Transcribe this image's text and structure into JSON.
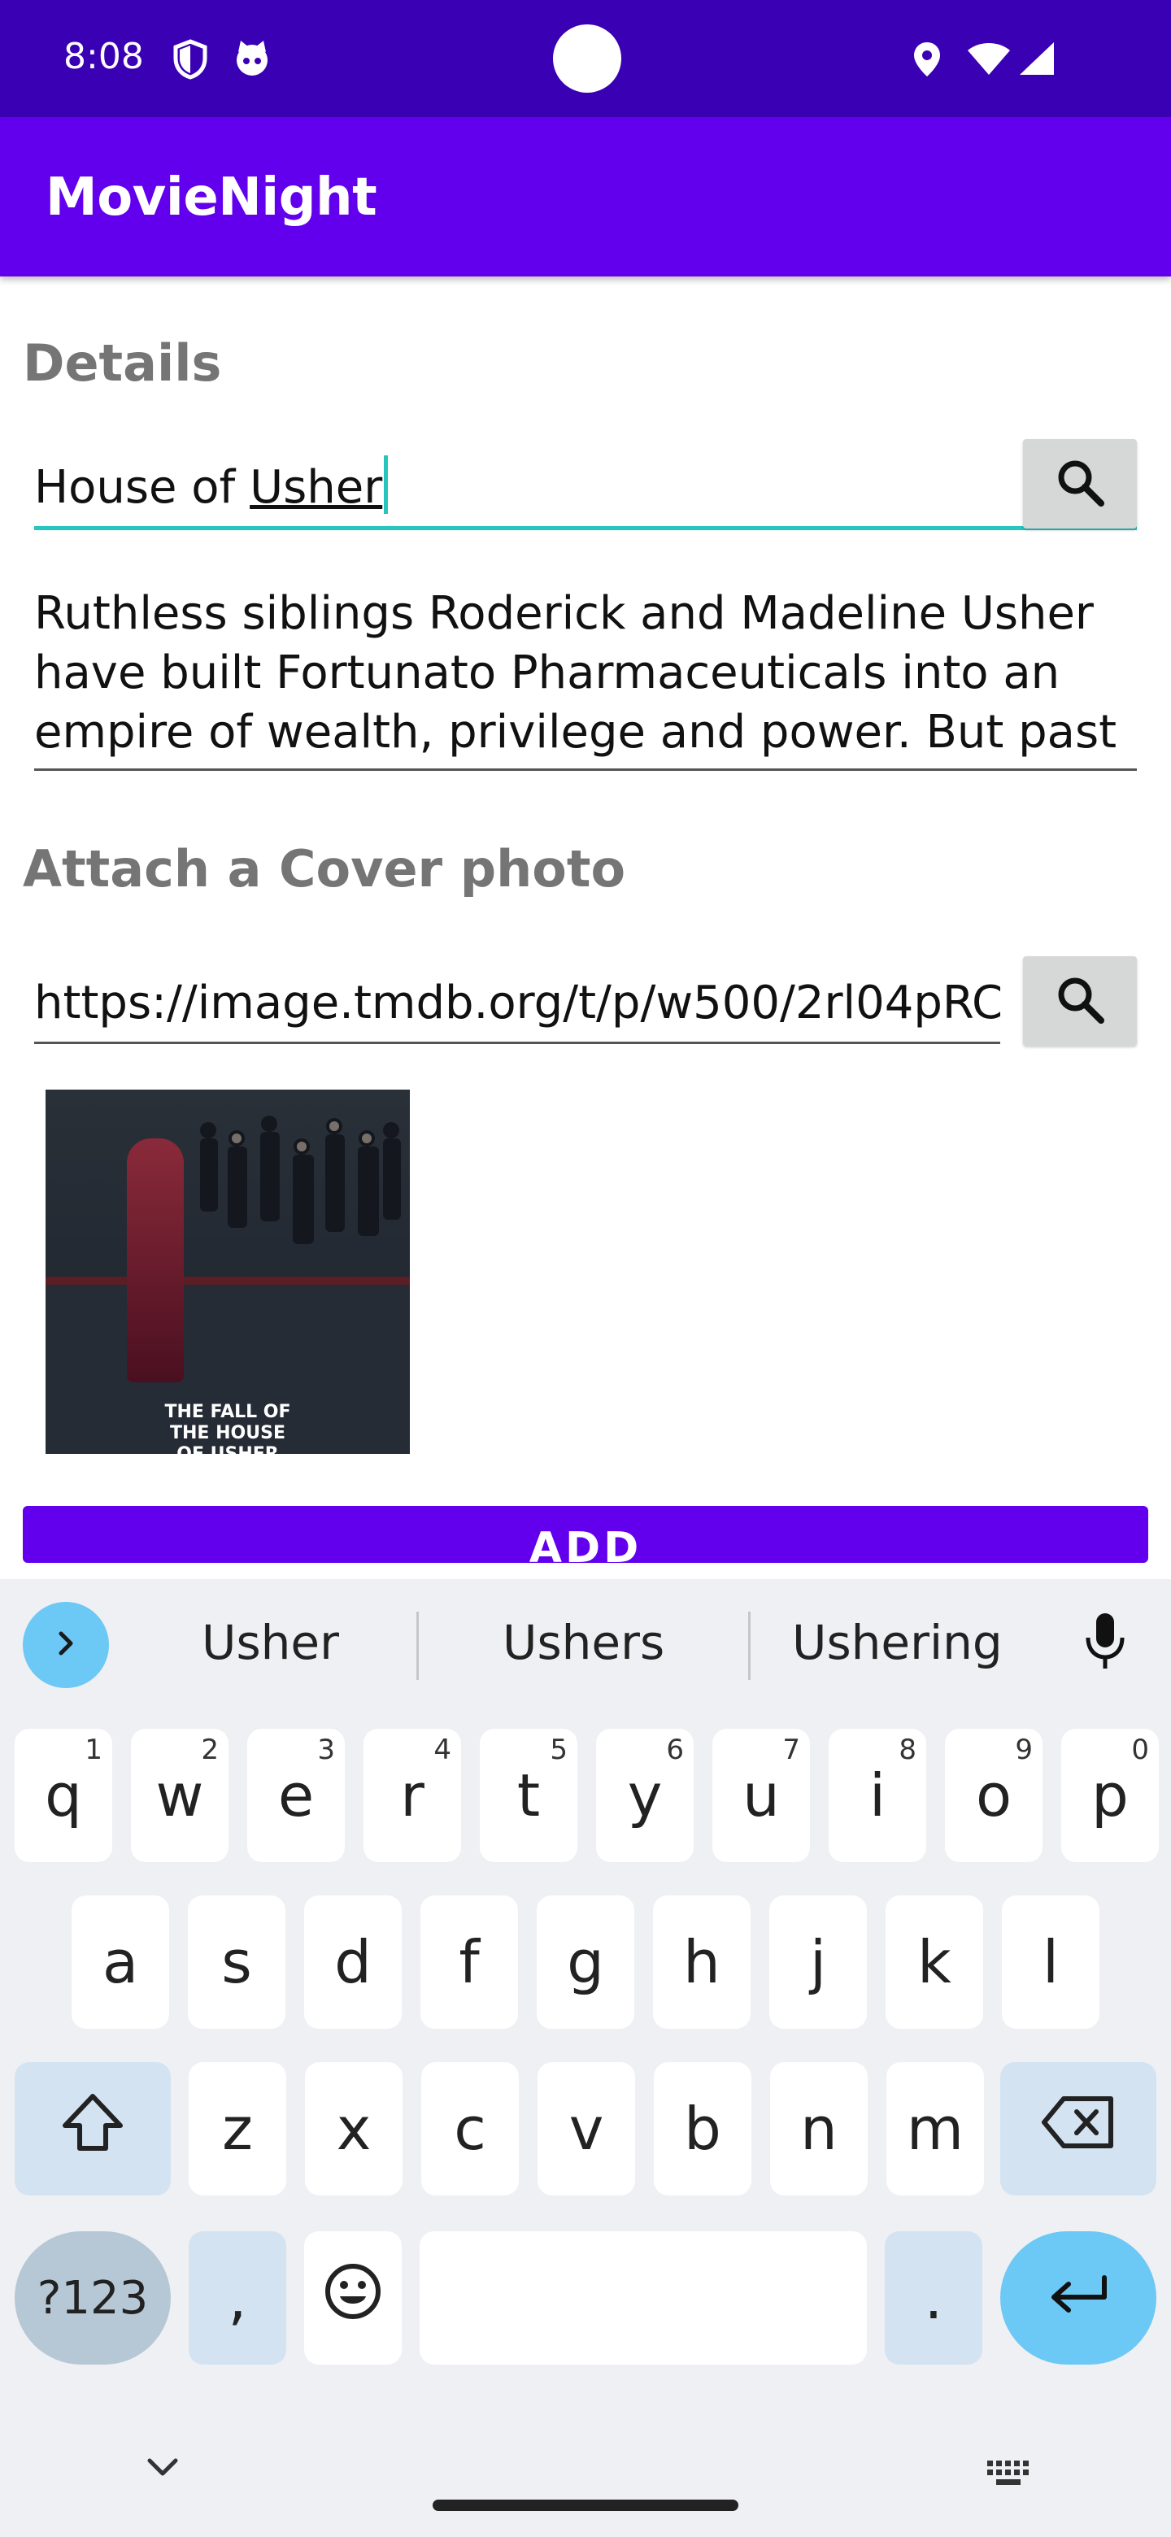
{
  "status_bar": {
    "time": "8:08"
  },
  "app": {
    "title": "MovieNight"
  },
  "form": {
    "details_label": "Details",
    "title_value_plain": "House of ",
    "title_value_underlined": "Usher",
    "description": "Ruthless siblings Roderick and Madeline Usher have built Fortunato Pharmaceuticals into an empire of wealth, privilege and power. But past",
    "cover_label": "Attach a Cover photo",
    "cover_url": "https://image.tmdb.org/t/p/w500/2rl04pRC",
    "poster_text": "THE FALL OF THE HOUSE OF USHER",
    "add_label": "ADD"
  },
  "keyboard": {
    "suggestions": [
      "Usher",
      "Ushers",
      "Ushering"
    ],
    "row1": [
      {
        "k": "q",
        "h": "1"
      },
      {
        "k": "w",
        "h": "2"
      },
      {
        "k": "e",
        "h": "3"
      },
      {
        "k": "r",
        "h": "4"
      },
      {
        "k": "t",
        "h": "5"
      },
      {
        "k": "y",
        "h": "6"
      },
      {
        "k": "u",
        "h": "7"
      },
      {
        "k": "i",
        "h": "8"
      },
      {
        "k": "o",
        "h": "9"
      },
      {
        "k": "p",
        "h": "0"
      }
    ],
    "row2": [
      "a",
      "s",
      "d",
      "f",
      "g",
      "h",
      "j",
      "k",
      "l"
    ],
    "row3": [
      "z",
      "x",
      "c",
      "v",
      "b",
      "n",
      "m"
    ],
    "symbols_label": "?123",
    "comma": ",",
    "period": "."
  },
  "colors": {
    "status_bar": "#3a00b4",
    "app_bar": "#6200ee",
    "accent": "#26c6bf",
    "enter_key": "#6cc8f4"
  }
}
